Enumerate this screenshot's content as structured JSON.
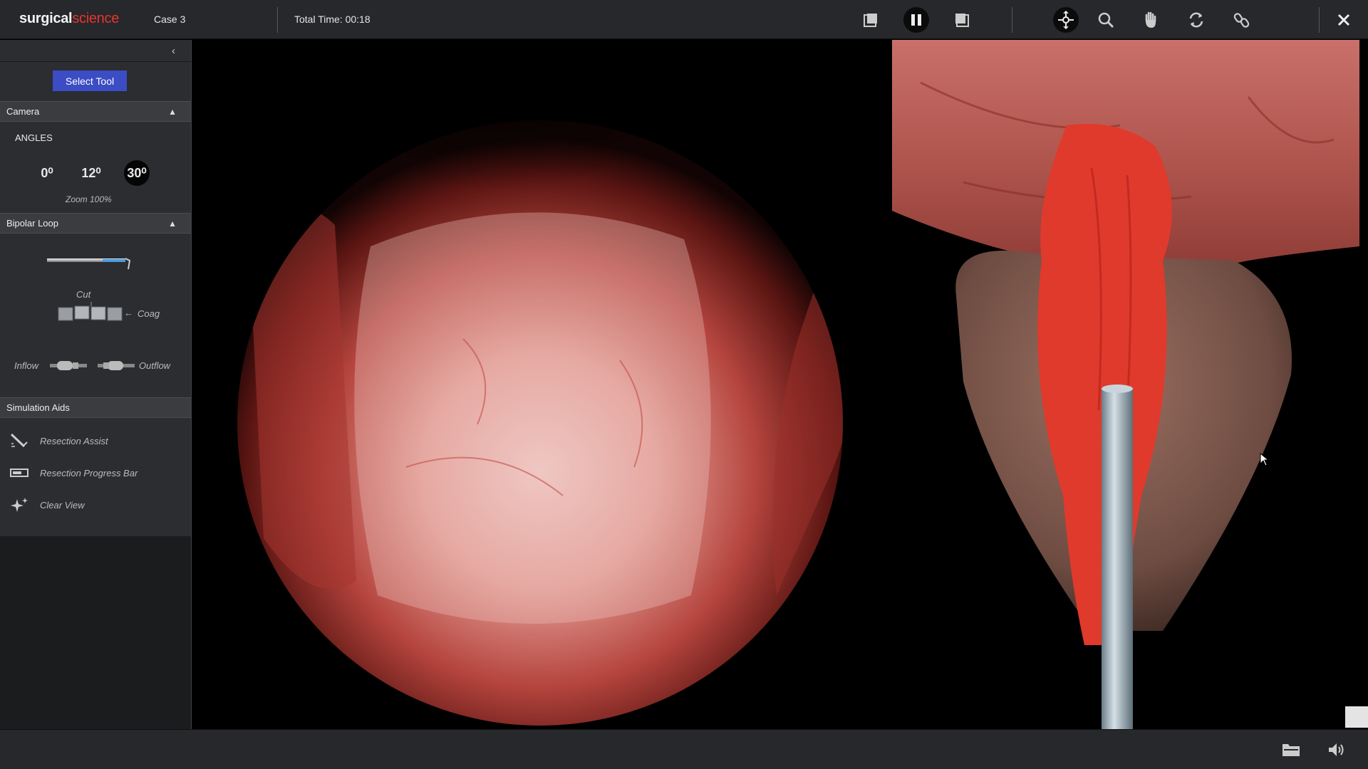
{
  "app": {
    "logo_primary": "surgical",
    "logo_secondary": "science",
    "case": "Case 3",
    "total_time": "Total Time: 00:18"
  },
  "toolbar": {
    "left_group": [
      "view-left-icon",
      "pause-icon",
      "view-right-icon"
    ],
    "right_group": [
      "rotate-move-icon",
      "search-icon",
      "hand-icon",
      "refresh-icon",
      "link-icon"
    ],
    "close": "close-icon"
  },
  "sidebar": {
    "select_tool_label": "Select Tool",
    "camera": {
      "title": "Camera",
      "angles_title": "ANGLES",
      "angles": [
        "0⁰",
        "12⁰",
        "30⁰"
      ],
      "active_angle_index": 2,
      "zoom": "Zoom 100%"
    },
    "bipolar": {
      "title": "Bipolar Loop",
      "cut": "Cut",
      "coag": "Coag",
      "inflow": "Inflow",
      "outflow": "Outflow"
    },
    "sim_aids": {
      "title": "Simulation Aids",
      "items": [
        {
          "label": "Resection Assist",
          "icon": "resection-assist-icon"
        },
        {
          "label": "Resection Progress Bar",
          "icon": "progress-bar-icon"
        },
        {
          "label": "Clear View",
          "icon": "sparkle-icon"
        }
      ]
    }
  },
  "colors": {
    "accent_button": "#3b4cc4",
    "logo_red": "#e5342e",
    "toolbar_bg": "#26282b"
  },
  "bottom": {
    "icons": [
      "folder-icon",
      "volume-icon"
    ]
  }
}
